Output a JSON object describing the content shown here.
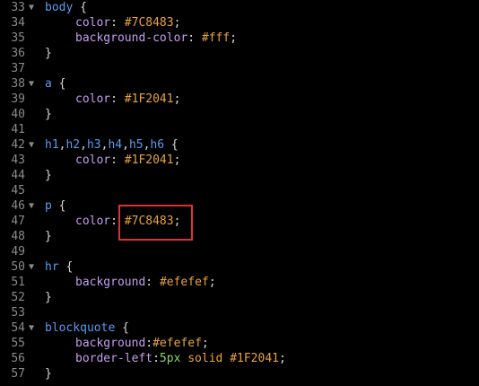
{
  "editor": {
    "lines": [
      {
        "num": "33",
        "fold": "▼",
        "parts": [
          {
            "c": "sel",
            "t": "body"
          },
          {
            "c": "punct",
            "t": " {"
          }
        ]
      },
      {
        "num": "34",
        "fold": "",
        "indent": true,
        "parts": [
          {
            "c": "prop",
            "t": "color"
          },
          {
            "c": "punct",
            "t": ": "
          },
          {
            "c": "val",
            "t": "#7C8483"
          },
          {
            "c": "punct",
            "t": ";"
          }
        ]
      },
      {
        "num": "35",
        "fold": "",
        "indent": true,
        "parts": [
          {
            "c": "prop",
            "t": "background-color"
          },
          {
            "c": "punct",
            "t": ": "
          },
          {
            "c": "val",
            "t": "#fff"
          },
          {
            "c": "punct",
            "t": ";"
          }
        ]
      },
      {
        "num": "36",
        "fold": "",
        "parts": [
          {
            "c": "punct",
            "t": "}"
          }
        ]
      },
      {
        "num": "37",
        "fold": "",
        "parts": []
      },
      {
        "num": "38",
        "fold": "▼",
        "parts": [
          {
            "c": "sel",
            "t": "a"
          },
          {
            "c": "punct",
            "t": " {"
          }
        ]
      },
      {
        "num": "39",
        "fold": "",
        "indent": true,
        "parts": [
          {
            "c": "prop",
            "t": "color"
          },
          {
            "c": "punct",
            "t": ": "
          },
          {
            "c": "val",
            "t": "#1F2041"
          },
          {
            "c": "punct",
            "t": ";"
          }
        ]
      },
      {
        "num": "40",
        "fold": "",
        "parts": [
          {
            "c": "punct",
            "t": "}"
          }
        ]
      },
      {
        "num": "41",
        "fold": "",
        "parts": []
      },
      {
        "num": "42",
        "fold": "▼",
        "parts": [
          {
            "c": "sel",
            "t": "h1"
          },
          {
            "c": "punct",
            "t": ","
          },
          {
            "c": "sel",
            "t": "h2"
          },
          {
            "c": "punct",
            "t": ","
          },
          {
            "c": "sel",
            "t": "h3"
          },
          {
            "c": "punct",
            "t": ","
          },
          {
            "c": "sel",
            "t": "h4"
          },
          {
            "c": "punct",
            "t": ","
          },
          {
            "c": "sel",
            "t": "h5"
          },
          {
            "c": "punct",
            "t": ","
          },
          {
            "c": "sel",
            "t": "h6"
          },
          {
            "c": "punct",
            "t": " {"
          }
        ]
      },
      {
        "num": "43",
        "fold": "",
        "indent": true,
        "parts": [
          {
            "c": "prop",
            "t": "color"
          },
          {
            "c": "punct",
            "t": ": "
          },
          {
            "c": "val",
            "t": "#1F2041"
          },
          {
            "c": "punct",
            "t": ";"
          }
        ]
      },
      {
        "num": "44",
        "fold": "",
        "parts": [
          {
            "c": "punct",
            "t": "}"
          }
        ]
      },
      {
        "num": "45",
        "fold": "",
        "parts": []
      },
      {
        "num": "46",
        "fold": "▼",
        "parts": [
          {
            "c": "sel",
            "t": "p"
          },
          {
            "c": "punct",
            "t": " {"
          }
        ]
      },
      {
        "num": "47",
        "fold": "",
        "indent": true,
        "parts": [
          {
            "c": "prop",
            "t": "color"
          },
          {
            "c": "punct",
            "t": ": "
          },
          {
            "c": "val",
            "t": "#7C8483"
          },
          {
            "c": "punct",
            "t": ";"
          }
        ]
      },
      {
        "num": "48",
        "fold": "",
        "parts": [
          {
            "c": "punct",
            "t": "}"
          }
        ]
      },
      {
        "num": "49",
        "fold": "",
        "parts": []
      },
      {
        "num": "50",
        "fold": "▼",
        "parts": [
          {
            "c": "sel",
            "t": "hr"
          },
          {
            "c": "punct",
            "t": " {"
          }
        ]
      },
      {
        "num": "51",
        "fold": "",
        "indent": true,
        "parts": [
          {
            "c": "prop",
            "t": "background"
          },
          {
            "c": "punct",
            "t": ": "
          },
          {
            "c": "val",
            "t": "#efefef"
          },
          {
            "c": "punct",
            "t": ";"
          }
        ]
      },
      {
        "num": "52",
        "fold": "",
        "parts": [
          {
            "c": "punct",
            "t": "}"
          }
        ]
      },
      {
        "num": "53",
        "fold": "",
        "parts": []
      },
      {
        "num": "54",
        "fold": "▼",
        "parts": [
          {
            "c": "sel",
            "t": "blockquote"
          },
          {
            "c": "punct",
            "t": " {"
          }
        ]
      },
      {
        "num": "55",
        "fold": "",
        "indent": true,
        "parts": [
          {
            "c": "prop",
            "t": "background"
          },
          {
            "c": "punct",
            "t": ":"
          },
          {
            "c": "val",
            "t": "#efefef"
          },
          {
            "c": "punct",
            "t": ";"
          }
        ]
      },
      {
        "num": "56",
        "fold": "",
        "indent": true,
        "parts": [
          {
            "c": "prop",
            "t": "border-left"
          },
          {
            "c": "punct",
            "t": ":"
          },
          {
            "c": "num",
            "t": "5px"
          },
          {
            "c": "val",
            "t": " solid #1F2041"
          },
          {
            "c": "punct",
            "t": ";"
          }
        ]
      },
      {
        "num": "57",
        "fold": "",
        "parts": [
          {
            "c": "punct",
            "t": "}"
          }
        ]
      }
    ]
  },
  "colors": {
    "background": "#000000",
    "selector": "#5b9bf0",
    "property": "#c79df1",
    "value": "#e8a33d",
    "number": "#8ed36b",
    "highlight": "#e03131"
  }
}
